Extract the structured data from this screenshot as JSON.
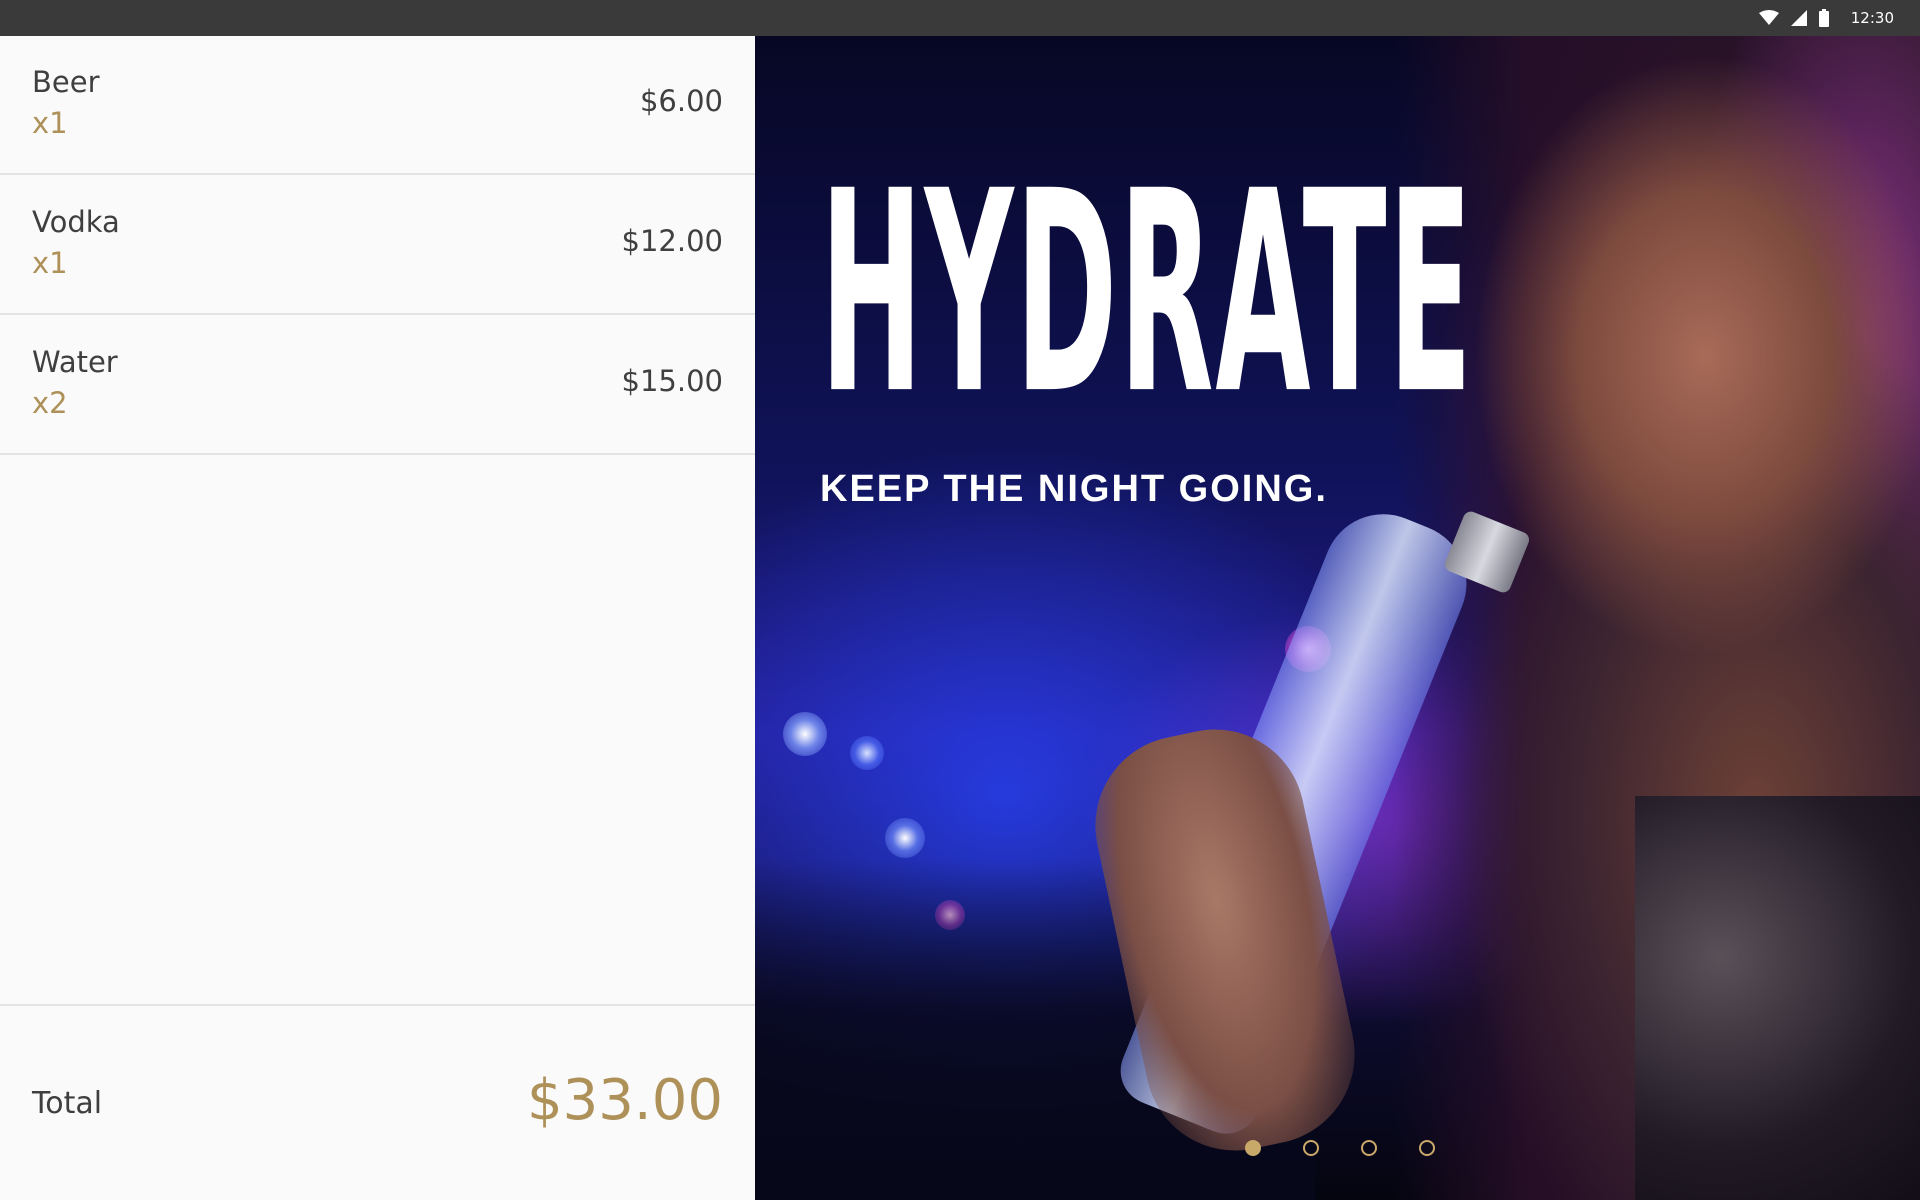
{
  "status_bar": {
    "time": "12:30",
    "icons": [
      "wifi-icon",
      "cell-signal-icon",
      "battery-icon"
    ]
  },
  "order": {
    "items": [
      {
        "name": "Beer",
        "qty": "x1",
        "price": "$6.00"
      },
      {
        "name": "Vodka",
        "qty": "x1",
        "price": "$12.00"
      },
      {
        "name": "Water",
        "qty": "x2",
        "price": "$15.00"
      }
    ],
    "total_label": "Total",
    "total_value": "$33.00"
  },
  "ad": {
    "headline": "HYDRATE",
    "tagline": "KEEP THE NIGHT GOING.",
    "carousel_pages": 4,
    "carousel_active_index": 0
  },
  "colors": {
    "accent": "#ae9059",
    "text": "#3f3f3f",
    "panel_bg": "#fafafa",
    "status_bar_bg": "#3a3a3a"
  }
}
